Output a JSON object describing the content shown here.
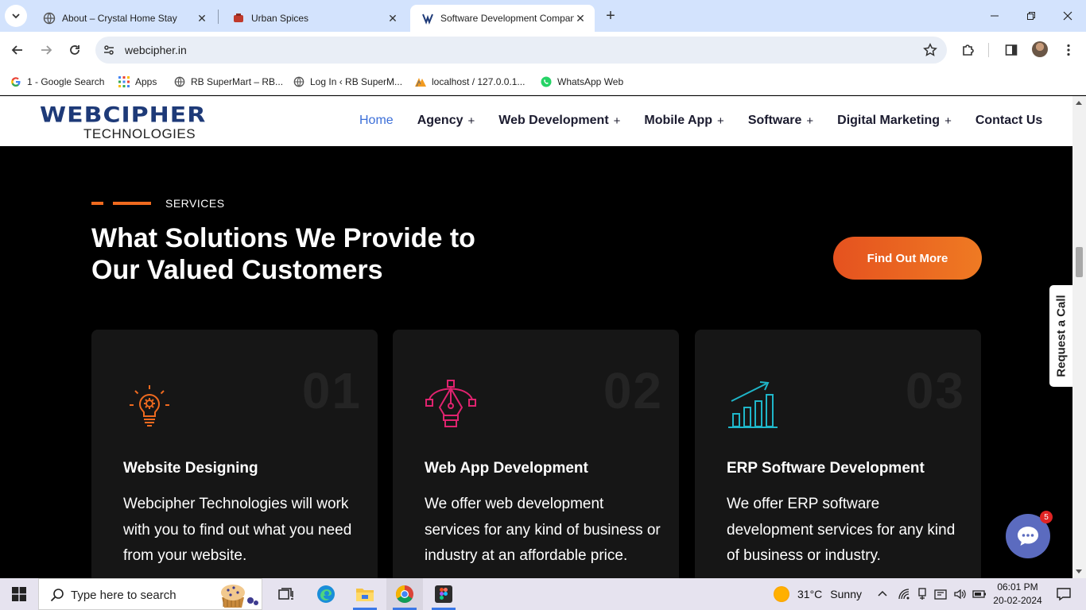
{
  "browser": {
    "tabs": [
      {
        "title": "About – Crystal Home Stay",
        "active": false
      },
      {
        "title": "Urban Spices",
        "active": false
      },
      {
        "title": "Software Development Company",
        "active": true
      }
    ],
    "url": "webcipher.in",
    "bookmarks": [
      {
        "label": "1 - Google Search"
      },
      {
        "label": "Apps"
      },
      {
        "label": "RB SuperMart – RB..."
      },
      {
        "label": "Log In ‹ RB SuperM..."
      },
      {
        "label": "localhost / 127.0.0.1..."
      },
      {
        "label": "WhatsApp Web"
      }
    ]
  },
  "site": {
    "logo": {
      "word": "WEBCIPHER",
      "sub": "TECHNOLOGIES"
    },
    "nav": [
      {
        "label": "Home",
        "active": true,
        "has_submenu": false
      },
      {
        "label": "Agency",
        "active": false,
        "has_submenu": true
      },
      {
        "label": "Web Development",
        "active": false,
        "has_submenu": true
      },
      {
        "label": "Mobile App",
        "active": false,
        "has_submenu": true
      },
      {
        "label": "Software",
        "active": false,
        "has_submenu": true
      },
      {
        "label": "Digital Marketing",
        "active": false,
        "has_submenu": true
      },
      {
        "label": "Contact Us",
        "active": false,
        "has_submenu": false
      }
    ],
    "nav_plus": "+",
    "section": {
      "eyebrow": "SERVICES",
      "heading_line1": "What Solutions We Provide to",
      "heading_line2": "Our Valued Customers",
      "cta": "Find Out More"
    },
    "cards": [
      {
        "num": "01",
        "title": "Website Designing",
        "desc": "Webcipher Technologies will work with you to find out what you need from your website.",
        "icon": "lightbulb-gear-icon",
        "color": "#ef6a1f"
      },
      {
        "num": "02",
        "title": "Web App Development",
        "desc": "We offer web development services for any kind of business or industry at an affordable price.",
        "icon": "pen-tool-icon",
        "color": "#e0236f"
      },
      {
        "num": "03",
        "title": "ERP Software Development",
        "desc": "We offer ERP software development services for any kind of business or industry.",
        "icon": "bar-chart-growth-icon",
        "color": "#1fb6c9"
      }
    ],
    "request_call": "Request a Call",
    "chat_badge": "5"
  },
  "taskbar": {
    "search_placeholder": "Type here to search",
    "weather_temp": "31°C",
    "weather_desc": "Sunny",
    "time": "06:01 PM",
    "date": "20-02-2024"
  }
}
